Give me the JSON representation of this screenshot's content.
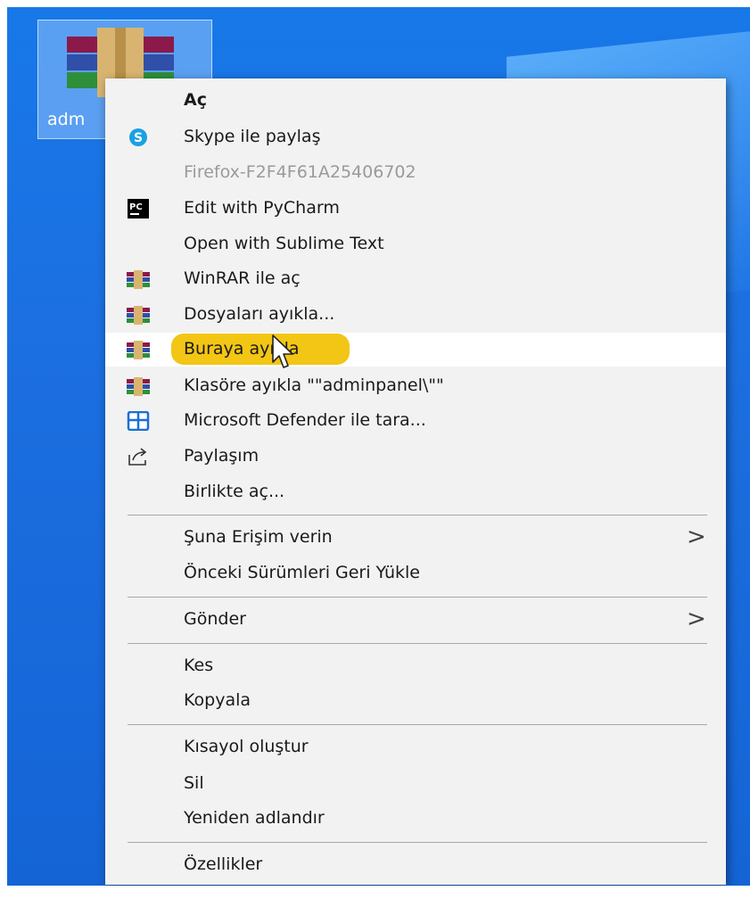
{
  "desktop": {
    "icon_label": "adm"
  },
  "menu": {
    "items": [
      {
        "label": "Aç",
        "icon": "none",
        "style": "bold"
      },
      {
        "label": "Skype ile paylaş",
        "icon": "skype-icon"
      },
      {
        "label": "Firefox-F2F4F61A25406702",
        "icon": "none",
        "style": "disabled"
      },
      {
        "label": "Edit with PyCharm",
        "icon": "pycharm-icon"
      },
      {
        "label": "Open with Sublime Text",
        "icon": "none"
      },
      {
        "label": "WinRAR ile aç",
        "icon": "winrar-icon"
      },
      {
        "label": "Dosyaları ayıkla...",
        "icon": "winrar-icon"
      },
      {
        "label": "Buraya ayıkla",
        "icon": "winrar-icon",
        "state": "hover-highlighted"
      },
      {
        "label": "Klasöre ayıkla \"\"adminpanel\\\"\"",
        "icon": "winrar-icon"
      },
      {
        "label": "Microsoft Defender ile tara...",
        "icon": "defender-icon"
      },
      {
        "label": "Paylaşım",
        "icon": "share-icon"
      },
      {
        "label": "Birlikte aç...",
        "icon": "none"
      },
      {
        "label": "Şuna Erişim verin",
        "icon": "none",
        "submenu": true
      },
      {
        "label": "Önceki Sürümleri Geri Yükle",
        "icon": "none"
      },
      {
        "label": "Gönder",
        "icon": "none",
        "submenu": true
      },
      {
        "label": "Kes",
        "icon": "none"
      },
      {
        "label": "Kopyala",
        "icon": "none"
      },
      {
        "label": "Kısayol oluştur",
        "icon": "none"
      },
      {
        "label": "Sil",
        "icon": "none"
      },
      {
        "label": "Yeniden adlandır",
        "icon": "none"
      },
      {
        "label": "Özellikler",
        "icon": "none"
      }
    ],
    "submenu_glyph": ">"
  },
  "colors": {
    "desktop": "#1878e8",
    "menu_bg": "#f2f2f2",
    "hover_bg": "#ffffff",
    "highlight": "#f3c515",
    "disabled_text": "#9a9a9a"
  }
}
